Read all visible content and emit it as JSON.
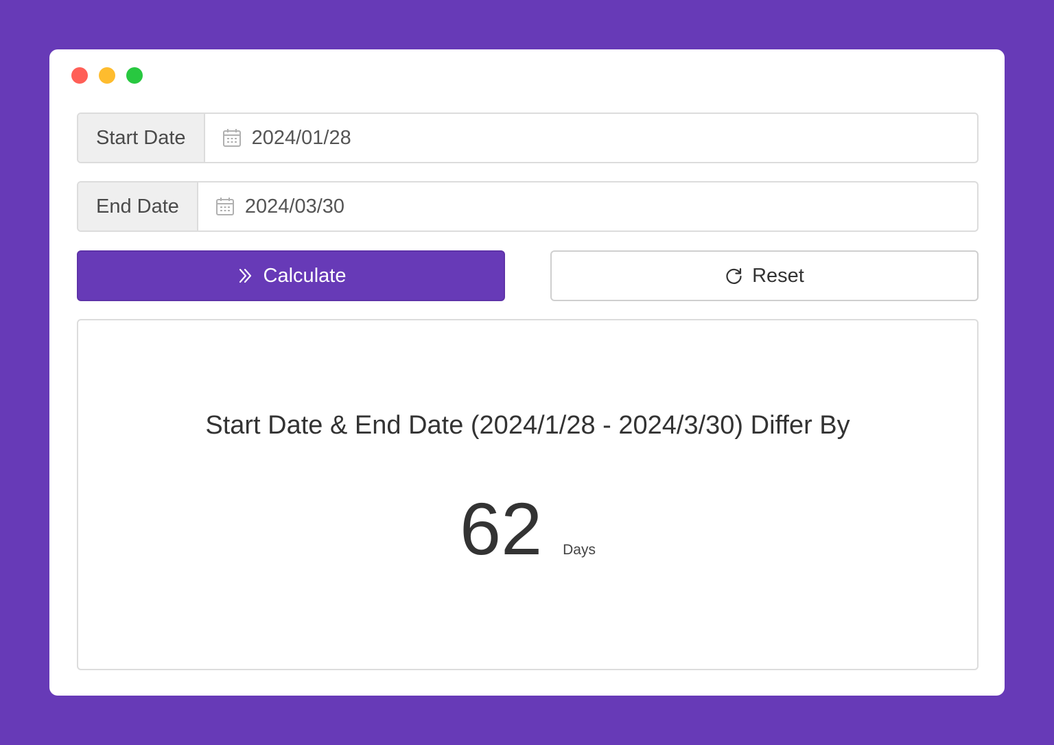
{
  "window": {
    "controls": [
      "close",
      "minimize",
      "maximize"
    ]
  },
  "start_date": {
    "label": "Start Date",
    "value": "2024/01/28",
    "icon": "calendar-icon"
  },
  "end_date": {
    "label": "End Date",
    "value": "2024/03/30",
    "icon": "calendar-icon"
  },
  "buttons": {
    "calculate_label": "Calculate",
    "calculate_icon": "double-chevron-right-icon",
    "reset_label": "Reset",
    "reset_icon": "refresh-icon"
  },
  "result": {
    "headline": "Start Date & End Date (2024/1/28 - 2024/3/30) Differ By",
    "number": "62",
    "unit": "Days"
  },
  "colors": {
    "background": "#673ab7",
    "accent": "#673ab7",
    "close": "#ff5f57",
    "minimize": "#febc2e",
    "maximize": "#28c840"
  }
}
